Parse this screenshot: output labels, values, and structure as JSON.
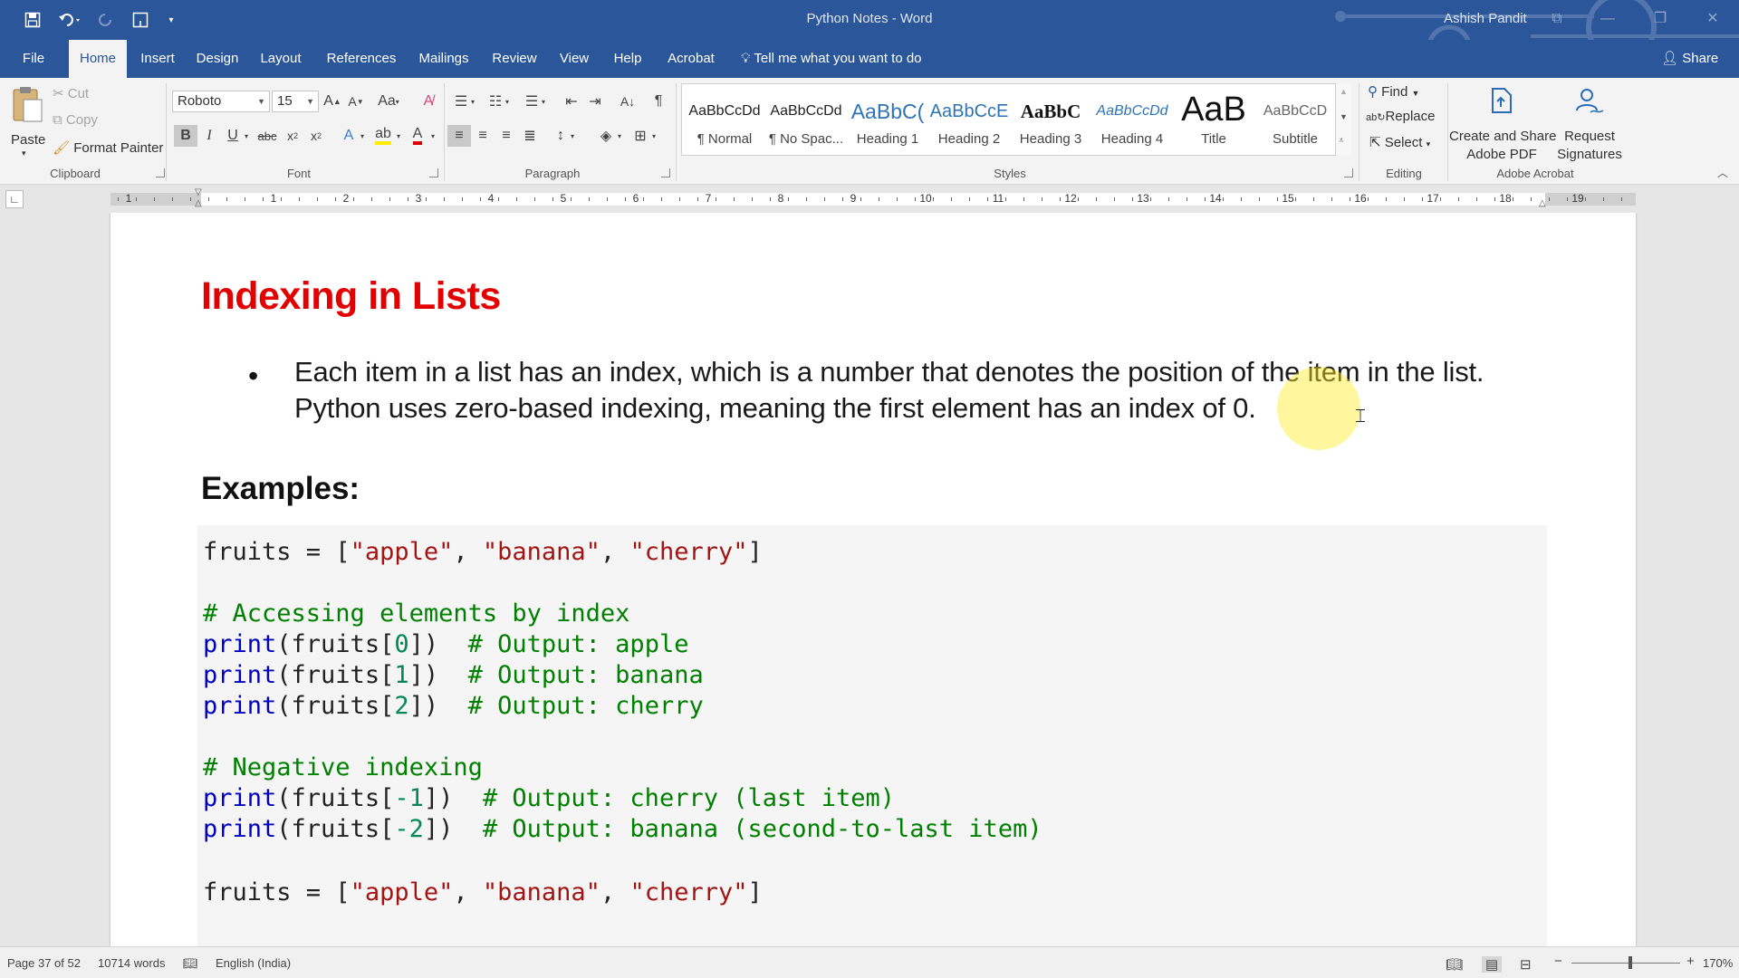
{
  "window": {
    "doc_title": "Python Notes  -  Word",
    "user_name": "Ashish Pandit"
  },
  "tabs": [
    {
      "label": "File"
    },
    {
      "label": "Home"
    },
    {
      "label": "Insert"
    },
    {
      "label": "Design"
    },
    {
      "label": "Layout"
    },
    {
      "label": "References"
    },
    {
      "label": "Mailings"
    },
    {
      "label": "Review"
    },
    {
      "label": "View"
    },
    {
      "label": "Help"
    },
    {
      "label": "Acrobat"
    }
  ],
  "tell_me": "Tell me what you want to do",
  "share_label": "Share",
  "clipboard": {
    "paste": "Paste",
    "cut": "Cut",
    "copy": "Copy",
    "format_painter": "Format Painter",
    "group": "Clipboard"
  },
  "font": {
    "family": "Roboto",
    "size": "15",
    "change_case": "Aa",
    "group": "Font"
  },
  "paragraph": {
    "group": "Paragraph"
  },
  "styles": {
    "group": "Styles",
    "items": [
      {
        "sample": "AaBbCcDd",
        "name": "¶ Normal"
      },
      {
        "sample": "AaBbCcDd",
        "name": "¶ No Spac..."
      },
      {
        "sample": "AaBbC(",
        "name": "Heading 1"
      },
      {
        "sample": "AaBbCcE",
        "name": "Heading 2"
      },
      {
        "sample": "AaBbC",
        "name": "Heading 3"
      },
      {
        "sample": "AaBbCcDd",
        "name": "Heading 4"
      },
      {
        "sample": "AaB",
        "name": "Title"
      },
      {
        "sample": "AaBbCcD",
        "name": "Subtitle"
      }
    ]
  },
  "editing": {
    "find": "Find",
    "replace": "Replace",
    "select": "Select",
    "group": "Editing"
  },
  "acrobat": {
    "create_share_1": "Create and Share",
    "create_share_2": "Adobe PDF",
    "request_1": "Request",
    "request_2": "Signatures",
    "group": "Adobe Acrobat"
  },
  "ruler": {
    "left_numbers": [
      "1"
    ],
    "numbers": [
      "1",
      "2",
      "3",
      "4",
      "5",
      "6",
      "7",
      "8",
      "9",
      "10",
      "11",
      "12",
      "13",
      "14",
      "15",
      "16",
      "17",
      "18",
      "19"
    ]
  },
  "document": {
    "heading": "Indexing in Lists",
    "bullet_symbol": "•",
    "body_line_1": "Each item in a list has an index, which is a number that denotes the position of the item in the list.",
    "body_line_2": "Python uses zero-based indexing, meaning the first element has an index of 0.",
    "examples_heading": "Examples:"
  },
  "code": {
    "l1": [
      "fruits = [",
      "\"apple\"",
      ", ",
      "\"banana\"",
      ", ",
      "\"cherry\"",
      "]"
    ],
    "c1": "# Accessing elements by index",
    "p1": [
      "print",
      "(fruits[",
      "0",
      "])  ",
      "# Output: apple"
    ],
    "p2": [
      "print",
      "(fruits[",
      "1",
      "])  ",
      "# Output: banana"
    ],
    "p3": [
      "print",
      "(fruits[",
      "2",
      "])  ",
      "# Output: cherry"
    ],
    "c2": "# Negative indexing",
    "n1": [
      "print",
      "(fruits[",
      "-1",
      "])  ",
      "# Output: cherry (last item)"
    ],
    "n2": [
      "print",
      "(fruits[",
      "-2",
      "])  ",
      "# Output: banana (second-to-last item)"
    ],
    "l2": [
      "fruits = [",
      "\"apple\"",
      ", ",
      "\"banana\"",
      ", ",
      "\"cherry\"",
      "]"
    ]
  },
  "status": {
    "page": "Page 37 of 52",
    "words": "10714 words",
    "language": "English (India)",
    "zoom": "170%"
  }
}
